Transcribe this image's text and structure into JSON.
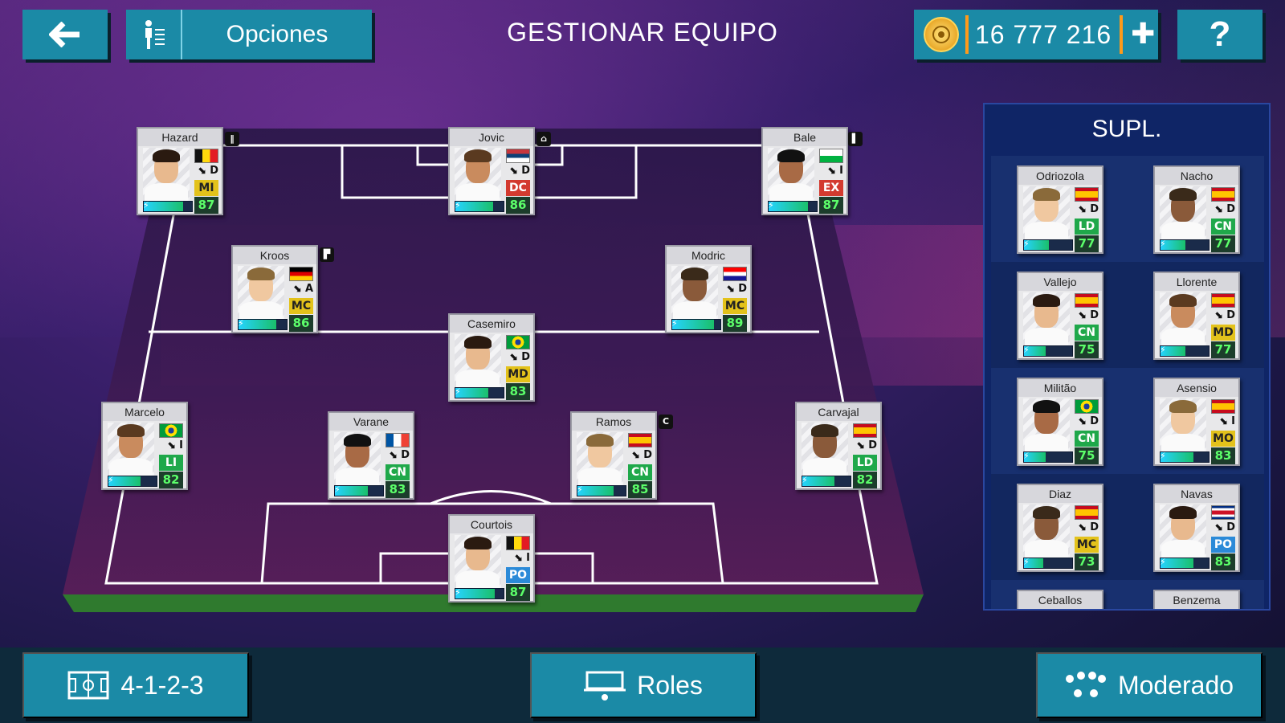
{
  "header": {
    "title": "GESTIONAR EQUIPO",
    "options_label": "Opciones",
    "coins": "16 777 216",
    "help": "?"
  },
  "bench": {
    "title": "SUPL.",
    "players": [
      {
        "name": "Odriozola",
        "foot": "D",
        "pos": "LD",
        "rating": "77",
        "flag": "ES",
        "line": "def"
      },
      {
        "name": "Nacho",
        "foot": "D",
        "pos": "CN",
        "rating": "77",
        "flag": "ES",
        "line": "def"
      },
      {
        "name": "Vallejo",
        "foot": "D",
        "pos": "CN",
        "rating": "75",
        "flag": "ES",
        "line": "def"
      },
      {
        "name": "Llorente",
        "foot": "D",
        "pos": "MD",
        "rating": "77",
        "flag": "ES",
        "line": "mid"
      },
      {
        "name": "Militão",
        "foot": "D",
        "pos": "CN",
        "rating": "75",
        "flag": "BR",
        "line": "def"
      },
      {
        "name": "Asensio",
        "foot": "I",
        "pos": "MO",
        "rating": "83",
        "flag": "ES",
        "line": "mid"
      },
      {
        "name": "Diaz",
        "foot": "D",
        "pos": "MC",
        "rating": "73",
        "flag": "ES",
        "line": "mid"
      },
      {
        "name": "Navas",
        "foot": "D",
        "pos": "PO",
        "rating": "83",
        "flag": "CR",
        "line": "gk"
      }
    ],
    "partial": [
      "Ceballos",
      "Benzema"
    ]
  },
  "lineup": [
    {
      "name": "Hazard",
      "foot": "D",
      "pos": "MI",
      "rating": "87",
      "flag": "BE",
      "line": "mid",
      "tag": "‖"
    },
    {
      "name": "Jovic",
      "foot": "D",
      "pos": "DC",
      "rating": "86",
      "flag": "RS",
      "line": "att",
      "tag": "⌂"
    },
    {
      "name": "Bale",
      "foot": "I",
      "pos": "EX",
      "rating": "87",
      "flag": "WAL",
      "line": "att",
      "tag": "▌"
    },
    {
      "name": "Kroos",
      "foot": "A",
      "pos": "MC",
      "rating": "86",
      "flag": "DE",
      "line": "mid",
      "tag": "▛"
    },
    {
      "name": "Modric",
      "foot": "D",
      "pos": "MC",
      "rating": "89",
      "flag": "HR",
      "line": "mid",
      "tag": ""
    },
    {
      "name": "Casemiro",
      "foot": "D",
      "pos": "MD",
      "rating": "83",
      "flag": "BR",
      "line": "mid",
      "tag": ""
    },
    {
      "name": "Marcelo",
      "foot": "I",
      "pos": "LI",
      "rating": "82",
      "flag": "BR",
      "line": "def",
      "tag": ""
    },
    {
      "name": "Varane",
      "foot": "D",
      "pos": "CN",
      "rating": "83",
      "flag": "FR",
      "line": "def",
      "tag": ""
    },
    {
      "name": "Ramos",
      "foot": "D",
      "pos": "CN",
      "rating": "85",
      "flag": "ES",
      "line": "def",
      "tag": "C"
    },
    {
      "name": "Carvajal",
      "foot": "D",
      "pos": "LD",
      "rating": "82",
      "flag": "ES",
      "line": "def",
      "tag": ""
    },
    {
      "name": "Courtois",
      "foot": "I",
      "pos": "PO",
      "rating": "87",
      "flag": "BE",
      "line": "gk",
      "tag": ""
    }
  ],
  "footer": {
    "formation": "4-1-2-3",
    "roles": "Roles",
    "mentality": "Moderado"
  }
}
